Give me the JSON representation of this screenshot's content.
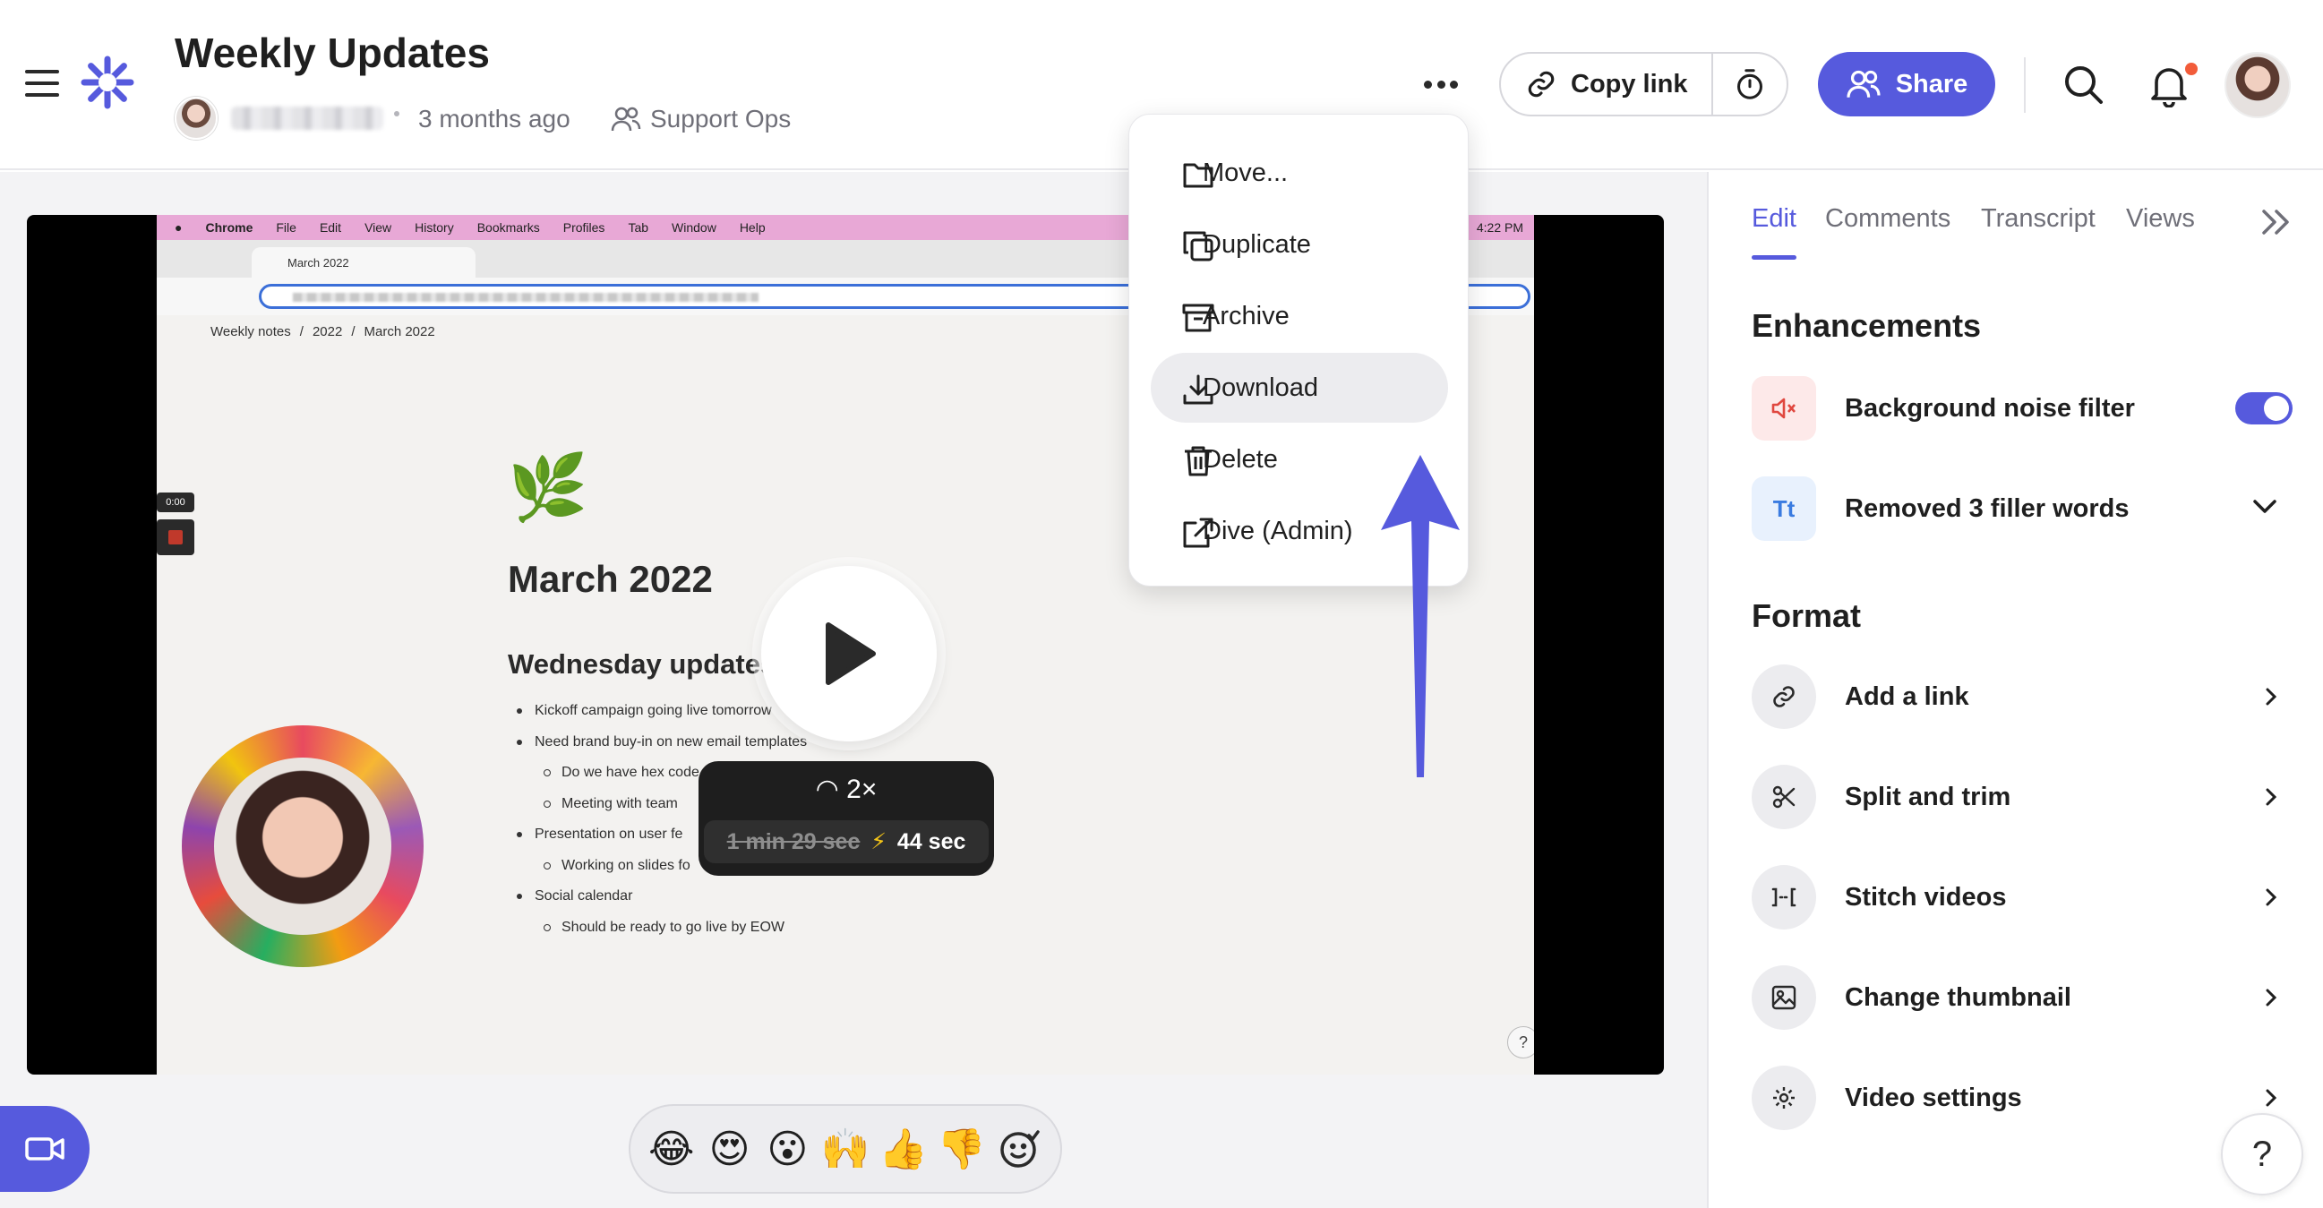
{
  "header": {
    "title": "Weekly Updates",
    "time_ago": "3 months ago",
    "space": "Support Ops",
    "copy_link": "Copy link",
    "share": "Share"
  },
  "menu": {
    "items": [
      {
        "label": "Move...",
        "icon": "folder-icon"
      },
      {
        "label": "Duplicate",
        "icon": "duplicate-icon"
      },
      {
        "label": "Archive",
        "icon": "archive-icon"
      },
      {
        "label": "Download",
        "icon": "download-icon",
        "active": true
      },
      {
        "label": "Delete",
        "icon": "trash-icon"
      },
      {
        "label": "Dive (Admin)",
        "icon": "external-link-icon"
      }
    ]
  },
  "video": {
    "mac_menu": [
      "Chrome",
      "File",
      "Edit",
      "View",
      "History",
      "Bookmarks",
      "Profiles",
      "Tab",
      "Window",
      "Help"
    ],
    "clock": "4:22 PM",
    "browser_tab": "March 2022",
    "breadcrumbs": [
      "Weekly notes",
      "2022",
      "March 2022"
    ],
    "doc_title": "March 2022",
    "doc_heading": "Wednesday updates",
    "doc_items": [
      {
        "level": 1,
        "text": "Kickoff campaign going live tomorrow"
      },
      {
        "level": 1,
        "text": "Need brand buy-in on new email templates"
      },
      {
        "level": 2,
        "text": "Do we have hex code"
      },
      {
        "level": 2,
        "text": "Meeting with team"
      },
      {
        "level": 1,
        "text": "Presentation on user fe"
      },
      {
        "level": 2,
        "text": "Working on slides fo"
      },
      {
        "level": 1,
        "text": "Social calendar"
      },
      {
        "level": 2,
        "text": "Should be ready to go live by EOW"
      }
    ],
    "recording_time": "0:00",
    "help": "?",
    "speed": "2×",
    "original_duration": "1 min 29 sec",
    "fast_duration": "44 sec"
  },
  "reactions": [
    "😂",
    "😍",
    "😮",
    "🙌",
    "👍",
    "👎"
  ],
  "panel": {
    "tabs": [
      "Edit",
      "Comments",
      "Transcript",
      "Views"
    ],
    "active_tab": "Edit",
    "enhancements_title": "Enhancements",
    "enhancements": [
      {
        "label": "Background noise filter",
        "icon": "mute-speaker-icon",
        "toggle_on": true
      },
      {
        "label": "Removed 3 filler words",
        "icon": "text-tt-icon"
      }
    ],
    "format_title": "Format",
    "format_items": [
      {
        "label": "Add a link",
        "icon": "link-icon"
      },
      {
        "label": "Split and trim",
        "icon": "scissors-icon"
      },
      {
        "label": "Stitch videos",
        "icon": "stitch-icon"
      },
      {
        "label": "Change thumbnail",
        "icon": "image-icon"
      },
      {
        "label": "Video settings",
        "icon": "gear-icon"
      }
    ],
    "help": "?"
  },
  "colors": {
    "accent": "#565add",
    "notification": "#f25c3a"
  }
}
